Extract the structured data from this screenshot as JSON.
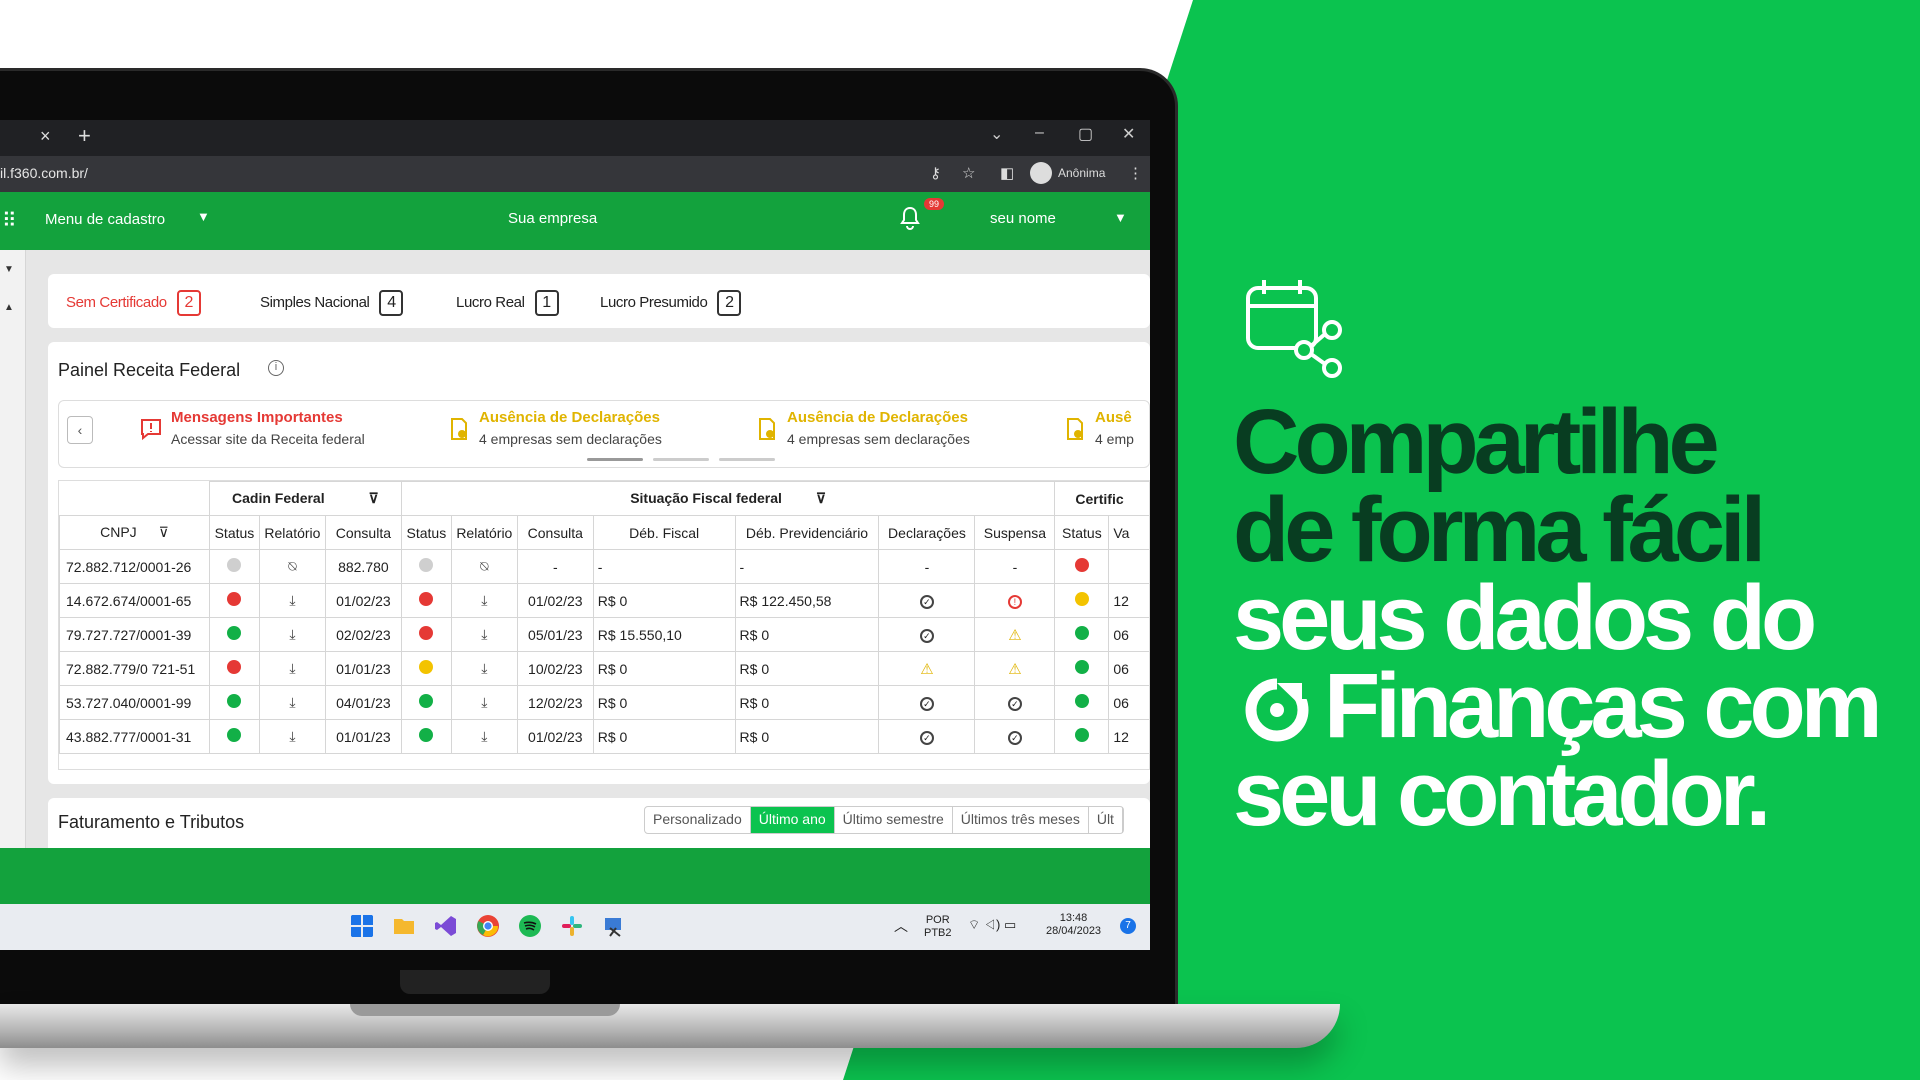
{
  "browser": {
    "tab_close": "×",
    "tab_new": "+",
    "url": "il.f360.com.br/",
    "profile_label": "Anônima",
    "window_controls": [
      "⌄",
      "–",
      "▢",
      "✕"
    ]
  },
  "app_header": {
    "menu_label": "Menu de cadastro",
    "company": "Sua empresa",
    "notification_count": "99",
    "user_name": "seu nome"
  },
  "regime_filters": [
    {
      "label": "Sem Certificado",
      "count": "2",
      "alert": true
    },
    {
      "label": "Simples Nacional",
      "count": "4",
      "alert": false
    },
    {
      "label": "Lucro Real",
      "count": "1",
      "alert": false
    },
    {
      "label": "Lucro Presumido",
      "count": "2",
      "alert": false
    }
  ],
  "receita_panel": {
    "title": "Painel Receita Federal",
    "messages": [
      {
        "title": "Mensagens Importantes",
        "subtitle": "Acessar site da Receita federal",
        "color": "#e53935"
      },
      {
        "title": "Ausência de Declarações",
        "subtitle": "4 empresas sem declarações",
        "color": "#e0b400"
      },
      {
        "title": "Ausência de Declarações",
        "subtitle": "4 empresas sem declarações",
        "color": "#e0b400"
      },
      {
        "title": "Ausê",
        "subtitle": "4 emp",
        "color": "#e0b400"
      }
    ],
    "groups": {
      "cadin": "Cadin Federal",
      "situacao": "Situação Fiscal federal",
      "certificado": "Certific"
    },
    "columns": [
      "CNPJ",
      "Status",
      "Relatório",
      "Consulta",
      "Status",
      "Relatório",
      "Consulta",
      "Déb. Fiscal",
      "Déb. Previdenciário",
      "Declarações",
      "Suspensa",
      "Status",
      "Va"
    ],
    "rows": [
      {
        "cnpj": "72.882.712/0001-26",
        "cad_status": "gray",
        "cad_rel": "none",
        "cad_cons": "882.780",
        "sit_status": "gray",
        "sit_rel": "none",
        "sit_cons": "-",
        "deb_fiscal": "-",
        "deb_prev": "-",
        "decl": "-",
        "susp": "-",
        "cert_status": "red",
        "cert_val": ""
      },
      {
        "cnpj": "14.672.674/0001-65",
        "cad_status": "red",
        "cad_rel": "download",
        "cad_cons": "01/02/23",
        "sit_status": "red",
        "sit_rel": "download",
        "sit_cons": "01/02/23",
        "deb_fiscal": "R$ 0",
        "deb_prev": "R$ 122.450,58",
        "decl": "ok",
        "susp": "error",
        "cert_status": "yellow",
        "cert_val": "12"
      },
      {
        "cnpj": "79.727.727/0001-39",
        "cad_status": "green",
        "cad_rel": "download",
        "cad_cons": "02/02/23",
        "sit_status": "red",
        "sit_rel": "download",
        "sit_cons": "05/01/23",
        "deb_fiscal": "R$ 15.550,10",
        "deb_prev": "R$ 0",
        "decl": "ok",
        "susp": "warn",
        "cert_status": "green",
        "cert_val": "06"
      },
      {
        "cnpj": "72.882.779/0 721-51",
        "cad_status": "red",
        "cad_rel": "download",
        "cad_cons": "01/01/23",
        "sit_status": "yellow",
        "sit_rel": "download",
        "sit_cons": "10/02/23",
        "deb_fiscal": "R$ 0",
        "deb_prev": "R$ 0",
        "decl": "warn",
        "susp": "warn",
        "cert_status": "green",
        "cert_val": "06"
      },
      {
        "cnpj": "53.727.040/0001-99",
        "cad_status": "green",
        "cad_rel": "download",
        "cad_cons": "04/01/23",
        "sit_status": "green",
        "sit_rel": "download",
        "sit_cons": "12/02/23",
        "deb_fiscal": "R$ 0",
        "deb_prev": "R$ 0",
        "decl": "ok",
        "susp": "ok",
        "cert_status": "green",
        "cert_val": "06"
      },
      {
        "cnpj": "43.882.777/0001-31",
        "cad_status": "green",
        "cad_rel": "download",
        "cad_cons": "01/01/23",
        "sit_status": "green",
        "sit_rel": "download",
        "sit_cons": "01/02/23",
        "deb_fiscal": "R$ 0",
        "deb_prev": "R$ 0",
        "decl": "ok",
        "susp": "ok",
        "cert_status": "green",
        "cert_val": "12"
      }
    ]
  },
  "faturamento": {
    "title": "Faturamento e Tributos",
    "periods": [
      "Personalizado",
      "Último ano",
      "Último semestre",
      "Últimos três meses",
      "Últ"
    ],
    "active_period": "Último ano"
  },
  "taskbar": {
    "lang_line1": "POR",
    "lang_line2": "PTB2",
    "time": "13:48",
    "date": "28/04/2023",
    "notif_count": "7"
  },
  "promo": {
    "headline_lines": [
      "Compartilhe",
      "de forma fácil",
      "seus dados do",
      "Finanças com",
      "seu contador."
    ],
    "icon": "calendar-share-icon",
    "brand_icon": "f360-logo-icon"
  },
  "colors": {
    "brand_green": "#0bc34f",
    "app_green": "#13a23d",
    "dark_green": "#083d21",
    "alert_red": "#e53935",
    "warn_yellow": "#e0b400"
  }
}
